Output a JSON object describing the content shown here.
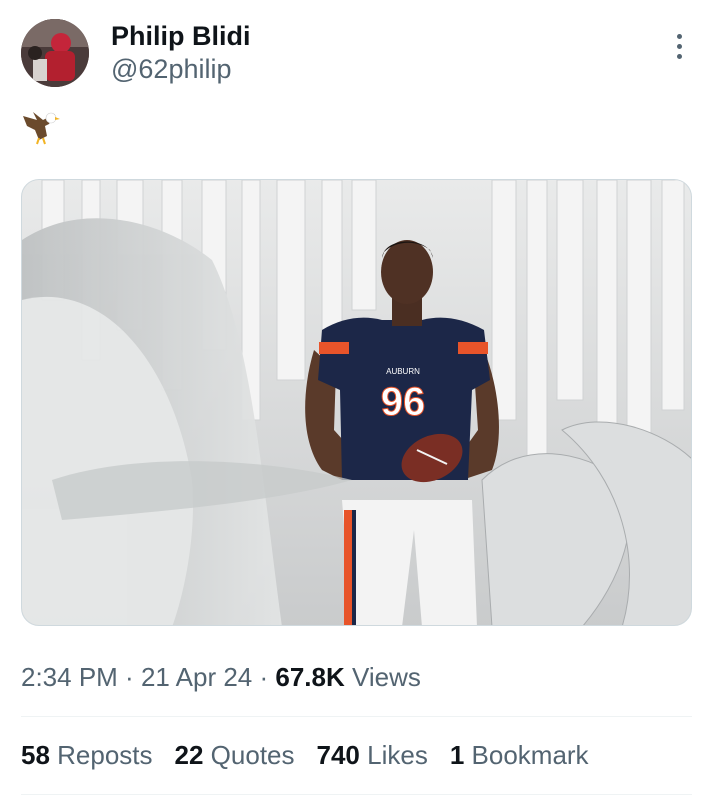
{
  "author": {
    "display_name": "Philip Blidi",
    "handle": "@62philip"
  },
  "tweet": {
    "emoji_icon": "eagle-emoji-icon"
  },
  "media": {
    "jersey_number": "96",
    "jersey_text": "AUBURN"
  },
  "meta": {
    "time": "2:34 PM",
    "separator": " · ",
    "date": "21 Apr 24",
    "views_count": "67.8K",
    "views_label": " Views"
  },
  "stats": {
    "reposts_count": "58",
    "reposts_label": " Reposts",
    "quotes_count": "22",
    "quotes_label": " Quotes",
    "likes_count": "740",
    "likes_label": " Likes",
    "bookmarks_count": "1",
    "bookmarks_label": " Bookmark"
  },
  "colors": {
    "text_primary": "#0f1419",
    "text_secondary": "#536471",
    "divider": "#eff3f4",
    "jersey_navy": "#1c2748",
    "jersey_orange": "#e8542a"
  }
}
